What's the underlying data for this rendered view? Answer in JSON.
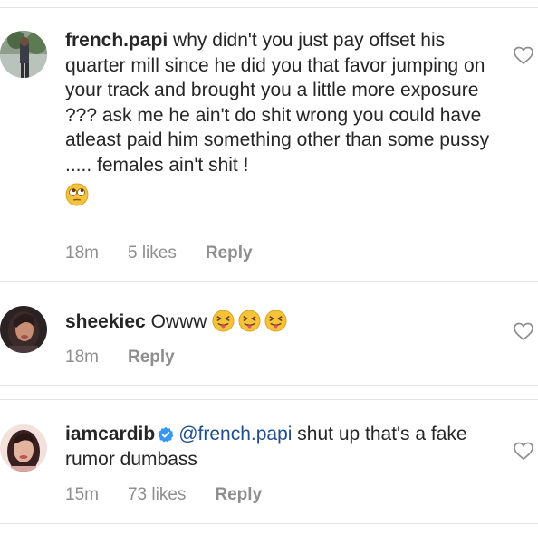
{
  "comments": [
    {
      "username": "french.papi",
      "text": " why didn't you just pay offset his quarter mill since he did you that favor jumping on your track and brought you a little more exposure ??? ask me he ain't do shit wrong you could have atleast paid him something other than some pussy ..... females ain't shit !",
      "emoji": "rolling-eyes-emoji",
      "time": "18m",
      "likes": "5 likes",
      "reply": "Reply"
    },
    {
      "username": "sheekiec",
      "text": " Owww",
      "emoji": "squinting-tongue-emoji",
      "time": "18m",
      "reply": "Reply"
    },
    {
      "username": "iamcardib",
      "verified": true,
      "mention": "@french.papi",
      "text": " shut up that's a fake rumor dumbass",
      "time": "15m",
      "likes": "73 likes",
      "reply": "Reply"
    }
  ],
  "colors": {
    "text": "#262626",
    "meta": "#8e8e8e",
    "mention": "#1f4e8c",
    "verified": "#3897f0",
    "divider": "#e3e3e3"
  }
}
